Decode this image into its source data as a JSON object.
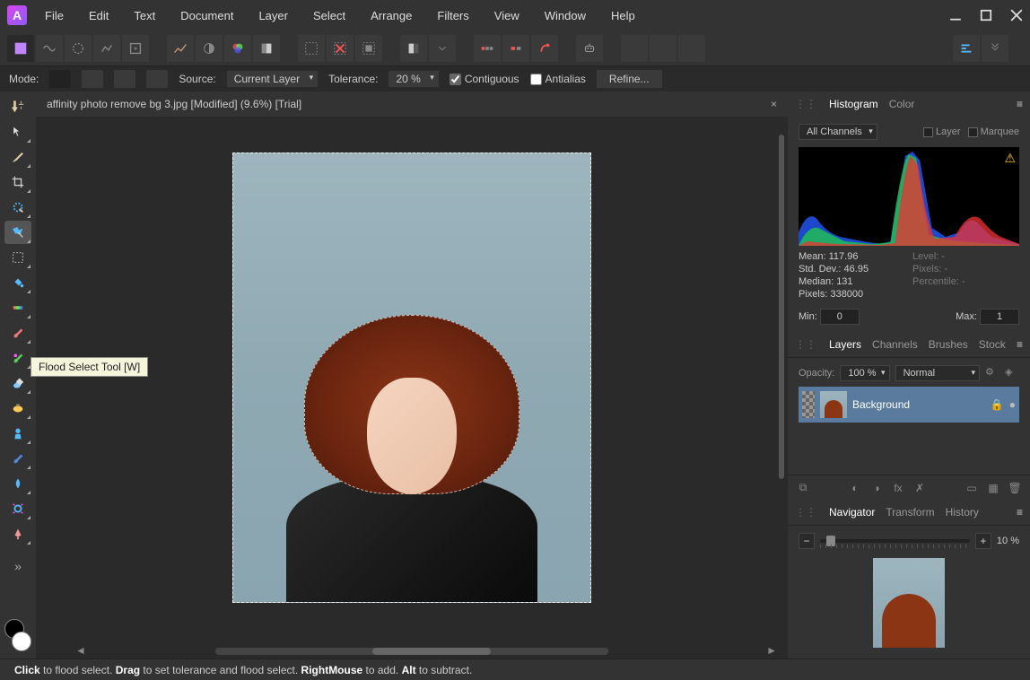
{
  "menu": [
    "File",
    "Edit",
    "Text",
    "Document",
    "Layer",
    "Select",
    "Arrange",
    "Filters",
    "View",
    "Window",
    "Help"
  ],
  "context": {
    "mode_label": "Mode:",
    "source_label": "Source:",
    "source_value": "Current Layer",
    "tolerance_label": "Tolerance:",
    "tolerance_value": "20 %",
    "contiguous": "Contiguous",
    "antialias": "Antialias",
    "refine": "Refine..."
  },
  "doc": {
    "title": "affinity photo remove bg 3.jpg [Modified] (9.6%) [Trial]"
  },
  "tooltip": "Flood Select Tool [W]",
  "panels": {
    "hist_tab": "Histogram",
    "color_tab": "Color",
    "hist_channel": "All Channels",
    "layer_cb": "Layer",
    "marquee_cb": "Marquee",
    "stats": {
      "mean": "Mean: 117.96",
      "level": "Level: -",
      "stddev": "Std. Dev.: 46.95",
      "pixels_r": "Pixels: -",
      "median": "Median: 131",
      "percentile": "Percentile: -",
      "pixels": "Pixels: 338000"
    },
    "min_label": "Min:",
    "min_value": "0",
    "max_label": "Max:",
    "max_value": "1",
    "layers_tab": "Layers",
    "channels_tab": "Channels",
    "brushes_tab": "Brushes",
    "stock_tab": "Stock",
    "opacity_label": "Opacity:",
    "opacity_value": "100 %",
    "blend_mode": "Normal",
    "layer_name": "Background",
    "nav_tab": "Navigator",
    "transform_tab": "Transform",
    "history_tab": "History",
    "zoom": "10 %"
  },
  "status": {
    "click": "Click",
    "click_txt": " to flood select. ",
    "drag": "Drag",
    "drag_txt": " to set tolerance and flood select. ",
    "right": "RightMouse",
    "right_txt": " to add. ",
    "alt": "Alt",
    "alt_txt": " to subtract."
  }
}
